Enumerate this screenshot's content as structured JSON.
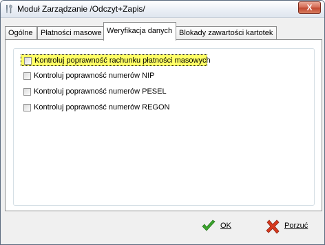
{
  "window": {
    "title": "Moduł Zarządzanie /Odczyt+Zapis/",
    "close_glyph": "X"
  },
  "tabs": [
    {
      "label": "Ogólne",
      "selected": false
    },
    {
      "label": "Płatności masowe",
      "selected": false
    },
    {
      "label": "Weryfikacja danych",
      "selected": true
    },
    {
      "label": "Blokady zawartości kartotek",
      "selected": false
    }
  ],
  "options": [
    {
      "label": "Kontroluj poprawność rachunku płatności masowych",
      "checked": false,
      "focused": true
    },
    {
      "label": "Kontroluj poprawność numerów NIP",
      "checked": false,
      "focused": false
    },
    {
      "label": "Kontroluj poprawność numerów PESEL",
      "checked": false,
      "focused": false
    },
    {
      "label": "Kontroluj poprawność numerów REGON",
      "checked": false,
      "focused": false
    }
  ],
  "buttons": {
    "ok_label": "OK",
    "cancel_label": "Porzuć"
  },
  "icons": {
    "app": "tools-icon",
    "ok": "checkmark-icon",
    "cancel": "cross-icon"
  },
  "colors": {
    "focus_highlight": "#ffff66",
    "ok_green": "#3aa52d",
    "cancel_red": "#d8391e",
    "close_button": "#c24a32"
  }
}
